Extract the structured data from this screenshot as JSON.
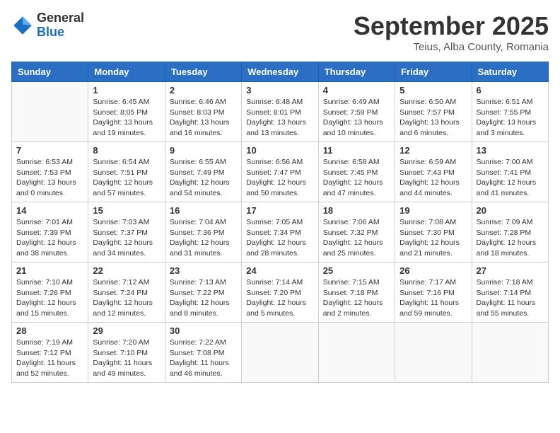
{
  "logo": {
    "general": "General",
    "blue": "Blue"
  },
  "title": {
    "month": "September 2025",
    "location": "Teius, Alba County, Romania"
  },
  "weekdays": [
    "Sunday",
    "Monday",
    "Tuesday",
    "Wednesday",
    "Thursday",
    "Friday",
    "Saturday"
  ],
  "weeks": [
    [
      {
        "day": "",
        "info": ""
      },
      {
        "day": "1",
        "info": "Sunrise: 6:45 AM\nSunset: 8:05 PM\nDaylight: 13 hours\nand 19 minutes."
      },
      {
        "day": "2",
        "info": "Sunrise: 6:46 AM\nSunset: 8:03 PM\nDaylight: 13 hours\nand 16 minutes."
      },
      {
        "day": "3",
        "info": "Sunrise: 6:48 AM\nSunset: 8:01 PM\nDaylight: 13 hours\nand 13 minutes."
      },
      {
        "day": "4",
        "info": "Sunrise: 6:49 AM\nSunset: 7:59 PM\nDaylight: 13 hours\nand 10 minutes."
      },
      {
        "day": "5",
        "info": "Sunrise: 6:50 AM\nSunset: 7:57 PM\nDaylight: 13 hours\nand 6 minutes."
      },
      {
        "day": "6",
        "info": "Sunrise: 6:51 AM\nSunset: 7:55 PM\nDaylight: 13 hours\nand 3 minutes."
      }
    ],
    [
      {
        "day": "7",
        "info": "Sunrise: 6:53 AM\nSunset: 7:53 PM\nDaylight: 13 hours\nand 0 minutes."
      },
      {
        "day": "8",
        "info": "Sunrise: 6:54 AM\nSunset: 7:51 PM\nDaylight: 12 hours\nand 57 minutes."
      },
      {
        "day": "9",
        "info": "Sunrise: 6:55 AM\nSunset: 7:49 PM\nDaylight: 12 hours\nand 54 minutes."
      },
      {
        "day": "10",
        "info": "Sunrise: 6:56 AM\nSunset: 7:47 PM\nDaylight: 12 hours\nand 50 minutes."
      },
      {
        "day": "11",
        "info": "Sunrise: 6:58 AM\nSunset: 7:45 PM\nDaylight: 12 hours\nand 47 minutes."
      },
      {
        "day": "12",
        "info": "Sunrise: 6:59 AM\nSunset: 7:43 PM\nDaylight: 12 hours\nand 44 minutes."
      },
      {
        "day": "13",
        "info": "Sunrise: 7:00 AM\nSunset: 7:41 PM\nDaylight: 12 hours\nand 41 minutes."
      }
    ],
    [
      {
        "day": "14",
        "info": "Sunrise: 7:01 AM\nSunset: 7:39 PM\nDaylight: 12 hours\nand 38 minutes."
      },
      {
        "day": "15",
        "info": "Sunrise: 7:03 AM\nSunset: 7:37 PM\nDaylight: 12 hours\nand 34 minutes."
      },
      {
        "day": "16",
        "info": "Sunrise: 7:04 AM\nSunset: 7:36 PM\nDaylight: 12 hours\nand 31 minutes."
      },
      {
        "day": "17",
        "info": "Sunrise: 7:05 AM\nSunset: 7:34 PM\nDaylight: 12 hours\nand 28 minutes."
      },
      {
        "day": "18",
        "info": "Sunrise: 7:06 AM\nSunset: 7:32 PM\nDaylight: 12 hours\nand 25 minutes."
      },
      {
        "day": "19",
        "info": "Sunrise: 7:08 AM\nSunset: 7:30 PM\nDaylight: 12 hours\nand 21 minutes."
      },
      {
        "day": "20",
        "info": "Sunrise: 7:09 AM\nSunset: 7:28 PM\nDaylight: 12 hours\nand 18 minutes."
      }
    ],
    [
      {
        "day": "21",
        "info": "Sunrise: 7:10 AM\nSunset: 7:26 PM\nDaylight: 12 hours\nand 15 minutes."
      },
      {
        "day": "22",
        "info": "Sunrise: 7:12 AM\nSunset: 7:24 PM\nDaylight: 12 hours\nand 12 minutes."
      },
      {
        "day": "23",
        "info": "Sunrise: 7:13 AM\nSunset: 7:22 PM\nDaylight: 12 hours\nand 8 minutes."
      },
      {
        "day": "24",
        "info": "Sunrise: 7:14 AM\nSunset: 7:20 PM\nDaylight: 12 hours\nand 5 minutes."
      },
      {
        "day": "25",
        "info": "Sunrise: 7:15 AM\nSunset: 7:18 PM\nDaylight: 12 hours\nand 2 minutes."
      },
      {
        "day": "26",
        "info": "Sunrise: 7:17 AM\nSunset: 7:16 PM\nDaylight: 11 hours\nand 59 minutes."
      },
      {
        "day": "27",
        "info": "Sunrise: 7:18 AM\nSunset: 7:14 PM\nDaylight: 11 hours\nand 55 minutes."
      }
    ],
    [
      {
        "day": "28",
        "info": "Sunrise: 7:19 AM\nSunset: 7:12 PM\nDaylight: 11 hours\nand 52 minutes."
      },
      {
        "day": "29",
        "info": "Sunrise: 7:20 AM\nSunset: 7:10 PM\nDaylight: 11 hours\nand 49 minutes."
      },
      {
        "day": "30",
        "info": "Sunrise: 7:22 AM\nSunset: 7:08 PM\nDaylight: 11 hours\nand 46 minutes."
      },
      {
        "day": "",
        "info": ""
      },
      {
        "day": "",
        "info": ""
      },
      {
        "day": "",
        "info": ""
      },
      {
        "day": "",
        "info": ""
      }
    ]
  ]
}
